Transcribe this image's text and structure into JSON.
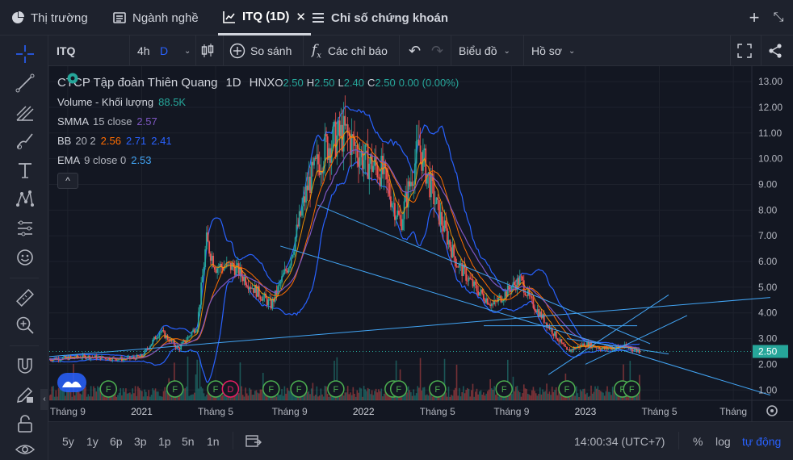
{
  "tabs": [
    {
      "label": "Thị trường",
      "icon": "pie-chart-icon"
    },
    {
      "label": "Ngành nghề",
      "icon": "list-icon"
    },
    {
      "label": "ITQ (1D)",
      "icon": "line-chart-icon",
      "active": true
    },
    {
      "label": "Chỉ số chứng khoán",
      "icon": "menu-icon"
    }
  ],
  "toolbar": {
    "symbol": "ITQ",
    "interval_1": "4h",
    "interval_2": "D",
    "compare": "So sánh",
    "indicators": "Các chỉ báo",
    "chart_type": "Biểu đồ",
    "profile": "Hồ sơ",
    "fx_symbol": "f",
    "fx_sub": "x"
  },
  "legend": {
    "name": "CTCP Tập đoàn Thiên Quang",
    "interval": "1D",
    "exchange": "HNX",
    "o_label": "O",
    "o_value": "2.50",
    "h_label": "H",
    "h_value": "2.50",
    "l_label": "L",
    "l_value": "2.40",
    "c_label": "C",
    "c_value": "2.50",
    "change": "0.00 (0.00%)",
    "volume_label": "Volume - Khối lượng",
    "volume_value": "88.5K",
    "smma_label": "SMMA",
    "smma_params": "15 close",
    "smma_value": "2.57",
    "bb_label": "BB",
    "bb_params": "20 2",
    "bb_v1": "2.56",
    "bb_v2": "2.71",
    "bb_v3": "2.41",
    "ema_label": "EMA",
    "ema_params": "9 close 0",
    "ema_value": "2.53",
    "collapse": "^"
  },
  "bottom": {
    "ranges": [
      "5y",
      "1y",
      "6p",
      "3p",
      "1p",
      "5n",
      "1n"
    ],
    "time": "14:00:34 (UTC+7)",
    "percent": "%",
    "log": "log",
    "auto": "tự động"
  },
  "colors": {
    "up": "#26a69a",
    "down": "#ef5350",
    "bb": "#2962ff",
    "smma": "#7e57c2",
    "ema": "#ff9800",
    "trend": "#42a5f5",
    "events": "#4caf50",
    "dividend": "#e91e63",
    "accent": "#2962ff",
    "last_price": "#26a69a"
  },
  "chart_data": {
    "type": "candlestick",
    "title": "CTCP Tập đoàn Thiên Quang",
    "last_price": 2.5,
    "y_ticks": [
      1.0,
      2.0,
      3.0,
      4.0,
      5.0,
      6.0,
      7.0,
      8.0,
      9.0,
      10.0,
      11.0,
      12.0,
      13.0
    ],
    "y_tick_labels": [
      "1.00",
      "2.00",
      "3.00",
      "4.00",
      "5.00",
      "6.00",
      "7.00",
      "8.00",
      "9.00",
      "10.00",
      "11.00",
      "12.00",
      "13.00"
    ],
    "last_price_label": "2.50",
    "ylim": [
      0.6,
      13.6
    ],
    "x_tick_labels": [
      "Tháng 9",
      "2021",
      "Tháng 5",
      "Tháng 9",
      "2022",
      "Tháng 5",
      "Tháng 9",
      "2023",
      "Tháng 5",
      "Tháng"
    ],
    "x_tick_months": [
      -4,
      0,
      4,
      8,
      12,
      16,
      20,
      24,
      28,
      32
    ],
    "x_range_months": [
      -5,
      33
    ],
    "price_path": [
      [
        -5,
        2.2
      ],
      [
        -3,
        2.3
      ],
      [
        -1,
        2.2
      ],
      [
        0,
        2.3
      ],
      [
        1,
        3.3
      ],
      [
        2,
        2.6
      ],
      [
        3,
        3.5
      ],
      [
        3.5,
        6.8
      ],
      [
        4,
        5.8
      ],
      [
        5,
        5.8
      ],
      [
        6,
        5.0
      ],
      [
        7,
        4.3
      ],
      [
        8,
        6.0
      ],
      [
        9,
        9.0
      ],
      [
        10,
        10.5
      ],
      [
        11,
        11.0
      ],
      [
        12,
        10.0
      ],
      [
        13,
        9.5
      ],
      [
        14,
        7.5
      ],
      [
        14.5,
        9.0
      ],
      [
        15,
        10.5
      ],
      [
        16,
        8.0
      ],
      [
        17,
        6.0
      ],
      [
        18,
        5.0
      ],
      [
        19,
        4.3
      ],
      [
        20,
        5.0
      ],
      [
        20.5,
        5.3
      ],
      [
        21,
        4.5
      ],
      [
        22,
        3.5
      ],
      [
        23,
        2.5
      ],
      [
        24,
        2.8
      ],
      [
        25,
        2.6
      ],
      [
        26,
        2.7
      ],
      [
        27,
        2.5
      ]
    ],
    "events": [
      {
        "month": -1.8,
        "label": "F"
      },
      {
        "month": 1.8,
        "label": "F"
      },
      {
        "month": 4.0,
        "label": "F"
      },
      {
        "month": 4.8,
        "label": "D"
      },
      {
        "month": 7.0,
        "label": "F"
      },
      {
        "month": 8.5,
        "label": "F"
      },
      {
        "month": 10.5,
        "label": "F"
      },
      {
        "month": 13.6,
        "label": "F"
      },
      {
        "month": 13.9,
        "label": "F"
      },
      {
        "month": 16.0,
        "label": "F"
      },
      {
        "month": 19.6,
        "label": "F"
      },
      {
        "month": 23.0,
        "label": "F"
      },
      {
        "month": 26.0,
        "label": "F"
      },
      {
        "month": 26.5,
        "label": "F"
      }
    ],
    "trendlines": [
      [
        [
          -5,
          2.3
        ],
        [
          34,
          4.6
        ]
      ],
      [
        [
          9.5,
          8.2
        ],
        [
          27.5,
          2.8
        ]
      ],
      [
        [
          7.5,
          6.6
        ],
        [
          34,
          0.8
        ]
      ],
      [
        [
          18.5,
          3.5
        ],
        [
          26.8,
          3.5
        ]
      ],
      [
        [
          22,
          1.6
        ],
        [
          28.5,
          4.7
        ]
      ],
      [
        [
          24,
          2.0
        ],
        [
          29.5,
          3.9
        ]
      ],
      [
        [
          23,
          3.0
        ],
        [
          28.5,
          2.4
        ]
      ]
    ]
  }
}
